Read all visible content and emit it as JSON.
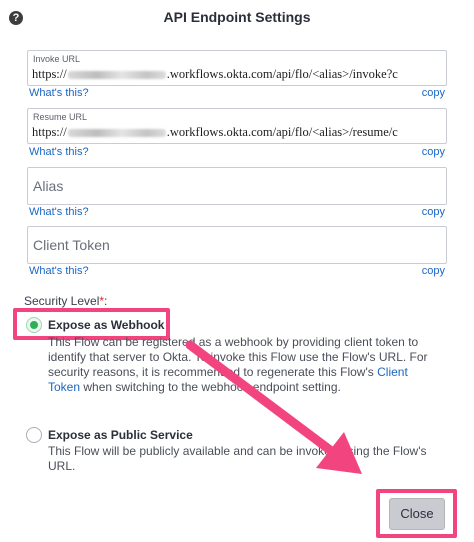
{
  "dialog": {
    "title": "API Endpoint Settings",
    "help_icon": "?"
  },
  "invoke_url": {
    "label": "Invoke URL",
    "value_prefix": "https://",
    "value_suffix": ".workflows.okta.com/api/flo/<alias>/invoke?c",
    "whats_this": "What's this?",
    "copy": "copy"
  },
  "resume_url": {
    "label": "Resume URL",
    "value_prefix": "https://",
    "value_suffix": ".workflows.okta.com/api/flo/<alias>/resume/c",
    "whats_this": "What's this?",
    "copy": "copy"
  },
  "alias": {
    "placeholder": "Alias",
    "whats_this": "What's this?",
    "copy": "copy"
  },
  "client_token": {
    "placeholder": "Client Token",
    "whats_this": "What's this?",
    "copy": "copy"
  },
  "security": {
    "label": "Security Level",
    "required_mark": "*",
    "colon": ":",
    "options": [
      {
        "title": "Expose as Webhook",
        "selected": true,
        "desc_part1": "This Flow can be registered as a webhook by providing client token to identify that server to Okta. To invoke this Flow use the Flow's URL. For security reasons, it is recommended to regenerate this Flow's ",
        "desc_link": "Client Token",
        "desc_part2": " when switching to the webhook endpoint setting."
      },
      {
        "title": "Expose as Public Service",
        "selected": false,
        "desc_part1": "This Flow will be publicly available and can be invoked using the Flow's URL."
      }
    ]
  },
  "footer": {
    "close_label": "Close"
  },
  "colors": {
    "accent_link": "#1a66c5",
    "highlight": "#f2457f",
    "selected_radio": "#2fae5a",
    "required": "#d42b2b"
  }
}
